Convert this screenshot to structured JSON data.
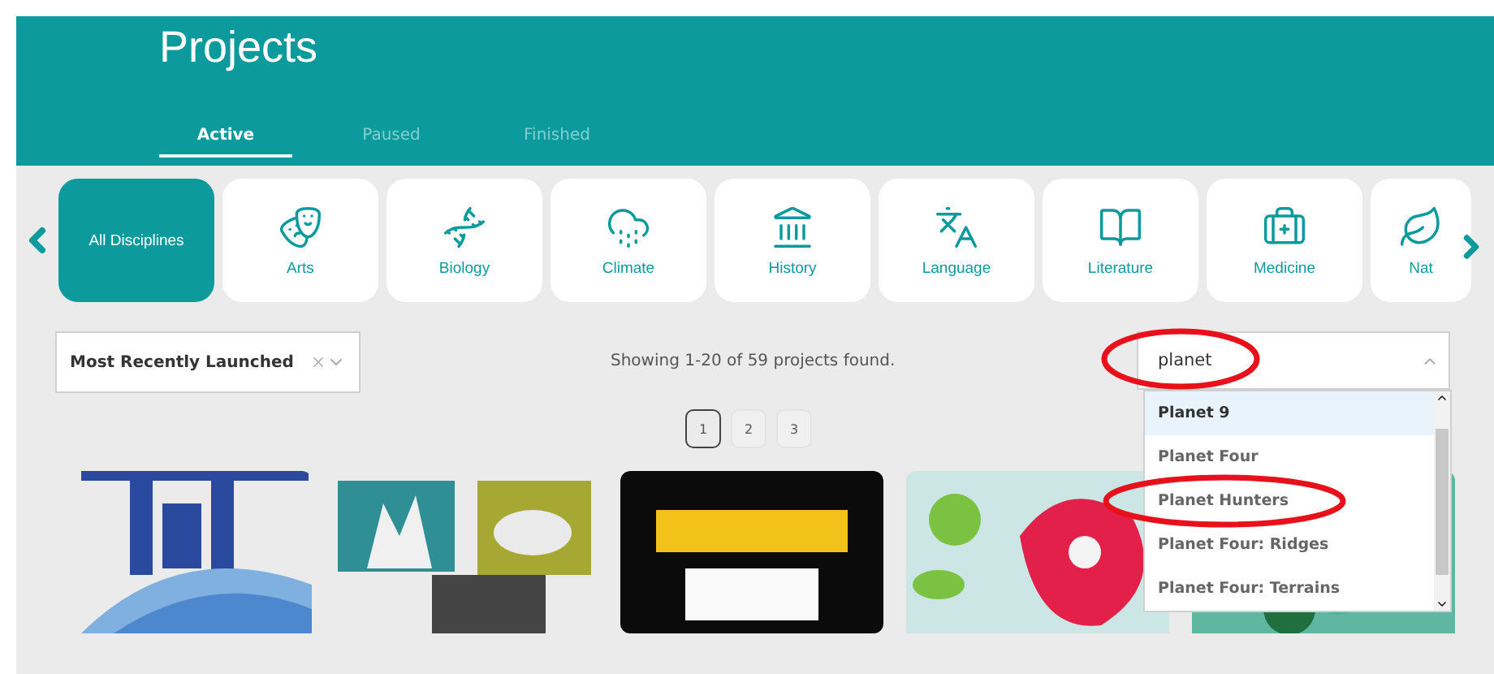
{
  "header": {
    "title": "Projects"
  },
  "tabs": [
    {
      "label": "Active",
      "selected": true
    },
    {
      "label": "Paused",
      "selected": false
    },
    {
      "label": "Finished",
      "selected": false
    }
  ],
  "disciplines": [
    {
      "kind": "all",
      "label": "All Disciplines",
      "selected": true
    },
    {
      "kind": "arts",
      "label": "Arts",
      "selected": false
    },
    {
      "kind": "biology",
      "label": "Biology",
      "selected": false
    },
    {
      "kind": "climate",
      "label": "Climate",
      "selected": false
    },
    {
      "kind": "history",
      "label": "History",
      "selected": false
    },
    {
      "kind": "language",
      "label": "Language",
      "selected": false
    },
    {
      "kind": "literature",
      "label": "Literature",
      "selected": false
    },
    {
      "kind": "medicine",
      "label": "Medicine",
      "selected": false
    },
    {
      "kind": "nature",
      "label": "Nat",
      "selected": false
    }
  ],
  "sort": {
    "value": "Most Recently Launched"
  },
  "results": "Showing 1-20 of 59 projects found.",
  "search": {
    "value": "planet",
    "circled": true
  },
  "suggestions": [
    {
      "label": "Planet 9",
      "highlighted": true,
      "circled": false
    },
    {
      "label": "Planet Four",
      "highlighted": false,
      "circled": false
    },
    {
      "label": "Planet Hunters",
      "highlighted": false,
      "circled": true
    },
    {
      "label": "Planet Four: Ridges",
      "highlighted": false,
      "circled": false
    },
    {
      "label": "Planet Four: Terrains",
      "highlighted": false,
      "circled": false
    }
  ],
  "pages": [
    {
      "label": "1",
      "selected": true
    },
    {
      "label": "2",
      "selected": false
    },
    {
      "label": "3",
      "selected": false
    }
  ]
}
